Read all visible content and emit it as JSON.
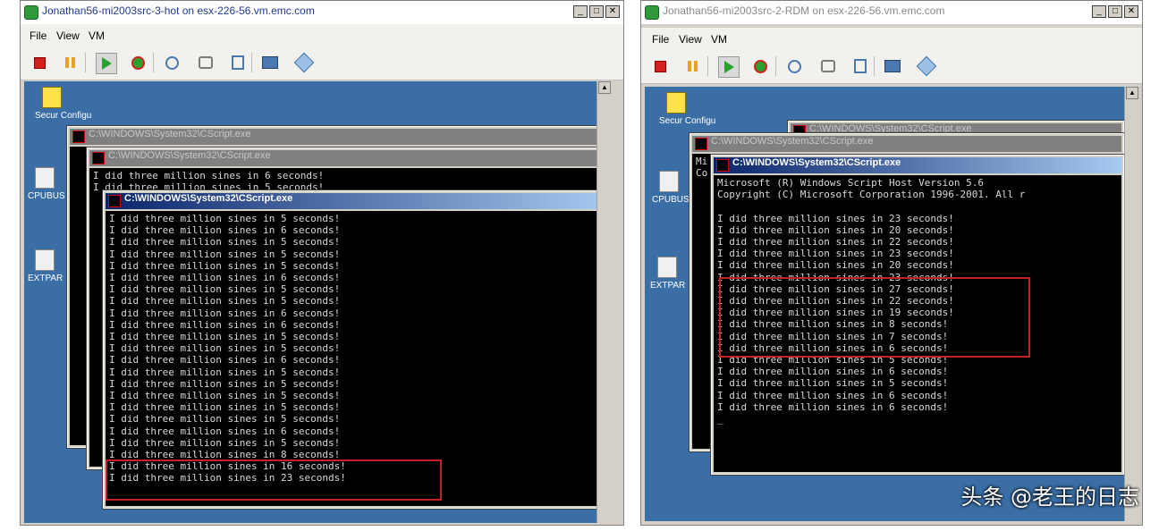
{
  "left_vm": {
    "title": "Jonathan56-mi2003src-3-hot on esx-226-56.vm.emc.com",
    "menu": [
      "File",
      "View",
      "VM"
    ],
    "desktop_icons": [
      "Secur Configu",
      "CPUBUS",
      "EXTPAR"
    ],
    "back_console_title": "C:\\WINDOWS\\System32\\CScript.exe",
    "mid_console_title": "C:\\WINDOWS\\System32\\CScript.exe",
    "mid_console_lines": [
      "I did three million sines in 6 seconds!",
      "I did three million sines in 5 seconds!"
    ],
    "front_console_title": "C:\\WINDOWS\\System32\\CScript.exe",
    "front_console_lines": [
      "I did three million sines in 5 seconds!",
      "I did three million sines in 6 seconds!",
      "I did three million sines in 5 seconds!",
      "I did three million sines in 5 seconds!",
      "I did three million sines in 5 seconds!",
      "I did three million sines in 6 seconds!",
      "I did three million sines in 5 seconds!",
      "I did three million sines in 5 seconds!",
      "I did three million sines in 6 seconds!",
      "I did three million sines in 6 seconds!",
      "I did three million sines in 5 seconds!",
      "I did three million sines in 5 seconds!",
      "I did three million sines in 6 seconds!",
      "I did three million sines in 5 seconds!",
      "I did three million sines in 5 seconds!",
      "I did three million sines in 5 seconds!",
      "I did three million sines in 5 seconds!",
      "I did three million sines in 5 seconds!",
      "I did three million sines in 6 seconds!",
      "I did three million sines in 5 seconds!",
      "I did three million sines in 8 seconds!",
      "I did three million sines in 16 seconds!",
      "I did three million sines in 23 seconds!"
    ]
  },
  "right_vm": {
    "title": "Jonathan56-mi2003src-2-RDM on esx-226-56.vm.emc.com",
    "menu": [
      "File",
      "View",
      "VM"
    ],
    "desktop_icons": [
      "Secur Configu",
      "CPUBUS",
      "EXTPAR"
    ],
    "back_console_title": "C:\\WINDOWS\\System32\\CScript.exe",
    "mid_console_title": "C:\\WINDOWS\\System32\\CScript.exe",
    "mid_console_lines": [
      "Mi",
      "Co"
    ],
    "front_console_title": "C:\\WINDOWS\\System32\\CScript.exe",
    "front_console_lines": [
      "Microsoft (R) Windows Script Host Version 5.6",
      "Copyright (C) Microsoft Corporation 1996-2001. All r",
      "",
      "I did three million sines in 23 seconds!",
      "I did three million sines in 20 seconds!",
      "I did three million sines in 22 seconds!",
      "I did three million sines in 23 seconds!",
      "I did three million sines in 20 seconds!",
      "I did three million sines in 23 seconds!",
      "I did three million sines in 27 seconds!",
      "I did three million sines in 22 seconds!",
      "I did three million sines in 19 seconds!",
      "I did three million sines in 8 seconds!",
      "I did three million sines in 7 seconds!",
      "I did three million sines in 6 seconds!",
      "I did three million sines in 5 seconds!",
      "I did three million sines in 6 seconds!",
      "I did three million sines in 5 seconds!",
      "I did three million sines in 6 seconds!",
      "I did three million sines in 6 seconds!",
      "_"
    ]
  },
  "watermark": "头条 @老王的日志",
  "colors": {
    "highlight": "#c62020",
    "guest_desktop": "#3a6ea5",
    "active_title": "#0a246a"
  }
}
